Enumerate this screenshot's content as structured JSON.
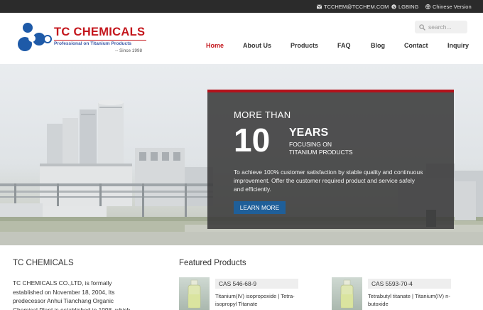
{
  "topbar": {
    "email": "TCCHEM@TCCHEM.COM",
    "skype": "LGBING",
    "language": "Chinese Version"
  },
  "header": {
    "brand": "TC CHEMICALS",
    "tagline": "Professional on Titanium Products",
    "since": "-- Since 1998",
    "search_placeholder": "search..."
  },
  "nav": {
    "items": [
      "Home",
      "About Us",
      "Products",
      "FAQ",
      "Blog",
      "Contact",
      "Inquiry"
    ],
    "active": "Home"
  },
  "hero": {
    "more_than": "MORE THAN",
    "number": "10",
    "years": "YEARS",
    "focus_line1": "FOCUSING ON",
    "focus_line2": "TITANIUM PRODUCTS",
    "description": "To achieve 100% customer satisfaction by stable quality and continuous improvement. Offer the customer required product and service safely and efficiently.",
    "button": "LEARN MORE"
  },
  "about": {
    "title": "TC CHEMICALS",
    "text": "TC CHEMICALS CO.,LTD, is formally established on November 18, 2004, Its predecessor Anhui Tianchang Organic Chemical Plant is established in 1998, which"
  },
  "featured": {
    "title": "Featured Products",
    "products": [
      {
        "cas": "CAS 546-68-9",
        "name": "Titanium(IV) isopropoxide | Tetra-isopropyl Titanate"
      },
      {
        "cas": "CAS 5593-70-4",
        "name": "Tetrabutyl titanate | Titanium(IV) n-butoxide"
      }
    ]
  },
  "colors": {
    "brand_red": "#c4161c",
    "topbar": "#2b2b2b",
    "button_blue": "#1f5f99",
    "logo_blue": "#1e5aa8"
  }
}
